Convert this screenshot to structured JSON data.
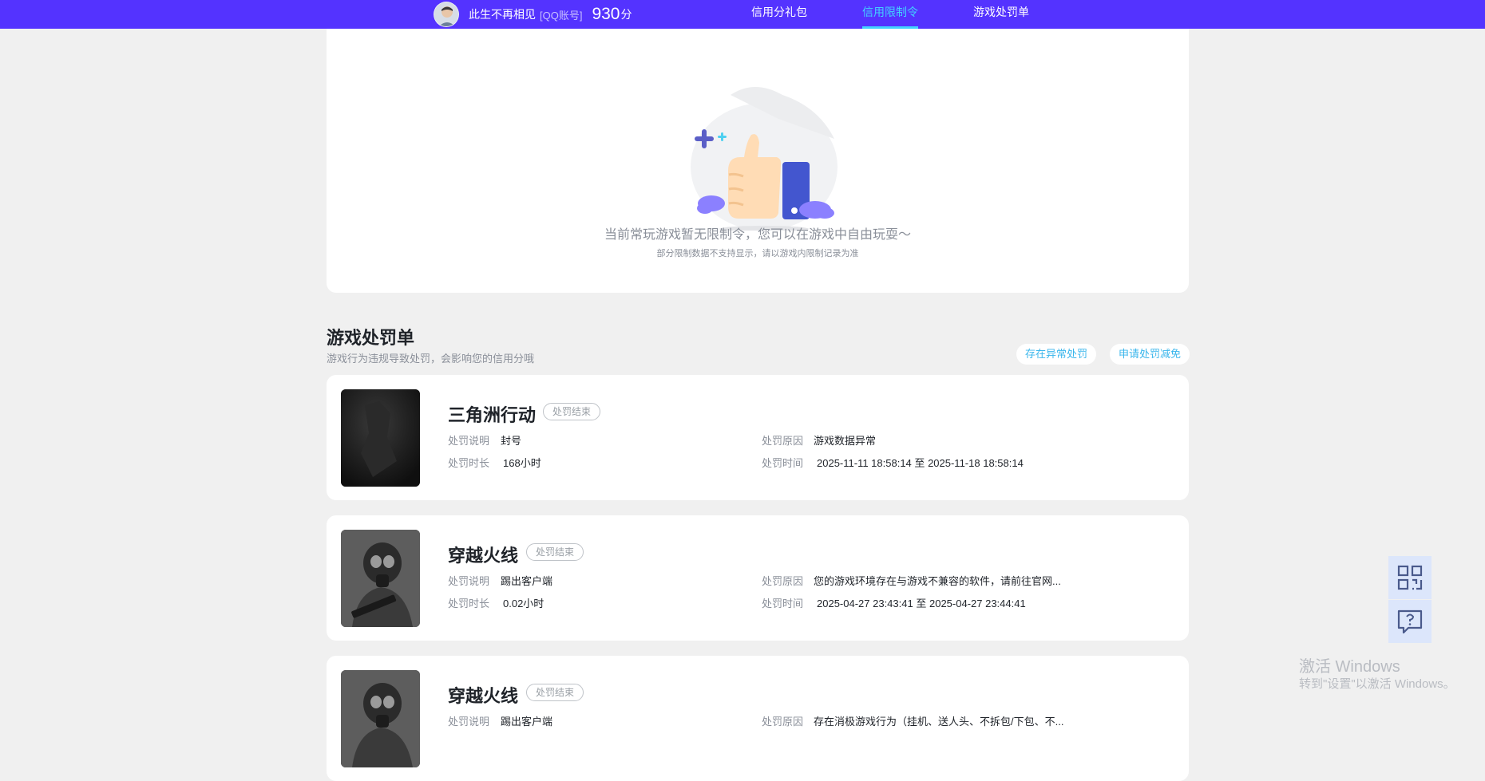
{
  "header": {
    "username": "此生不再相见",
    "account_type": "[QQ账号]",
    "score": "930",
    "score_unit": "分",
    "nav": [
      "信用分礼包",
      "信用限制令",
      "游戏处罚单"
    ],
    "active_nav": "信用限制令"
  },
  "restriction": {
    "empty_title": "当前常玩游戏暂无限制令，您可以在游戏中自由玩耍～",
    "empty_note": "部分限制数据不支持显示，请以游戏内限制记录为准"
  },
  "penalties": {
    "title": "游戏处罚单",
    "description": "游戏行为违规导致处罚，会影响您的信用分哦",
    "btn_abnormal": "存在异常处罚",
    "btn_reduce": "申请处罚减免",
    "labels": {
      "desc": "处罚说明",
      "duration": "处罚时长",
      "reason": "处罚原因",
      "time": "处罚时间"
    },
    "items": [
      {
        "game": "三角洲行动",
        "status": "处罚结束",
        "desc": "封号",
        "duration": "168小时",
        "reason": "游戏数据异常",
        "start": "2025-11-11 18:58:14",
        "sep": "至",
        "end": "2025-11-18 18:58:14"
      },
      {
        "game": "穿越火线",
        "status": "处罚结束",
        "desc": "踢出客户端",
        "duration": "0.02小时",
        "reason": "您的游戏环境存在与游戏不兼容的软件，请前往官网...",
        "start": "2025-04-27 23:43:41",
        "sep": "至",
        "end": "2025-04-27 23:44:41"
      },
      {
        "game": "穿越火线",
        "status": "处罚结束",
        "desc": "踢出客户端",
        "reason": "存在消极游戏行为（挂机、送人头、不拆包/下包、不..."
      }
    ]
  },
  "floating": {
    "icons": [
      "qrcode-icon",
      "help-chat-icon"
    ]
  },
  "watermark": {
    "line1": "激活 Windows",
    "line2": "转到\"设置\"以激活 Windows。"
  },
  "colors": {
    "topbar": "#5433ff",
    "active_nav": "#42d2ff",
    "link": "#39b6ec",
    "page_bg": "#f0f0f0"
  }
}
